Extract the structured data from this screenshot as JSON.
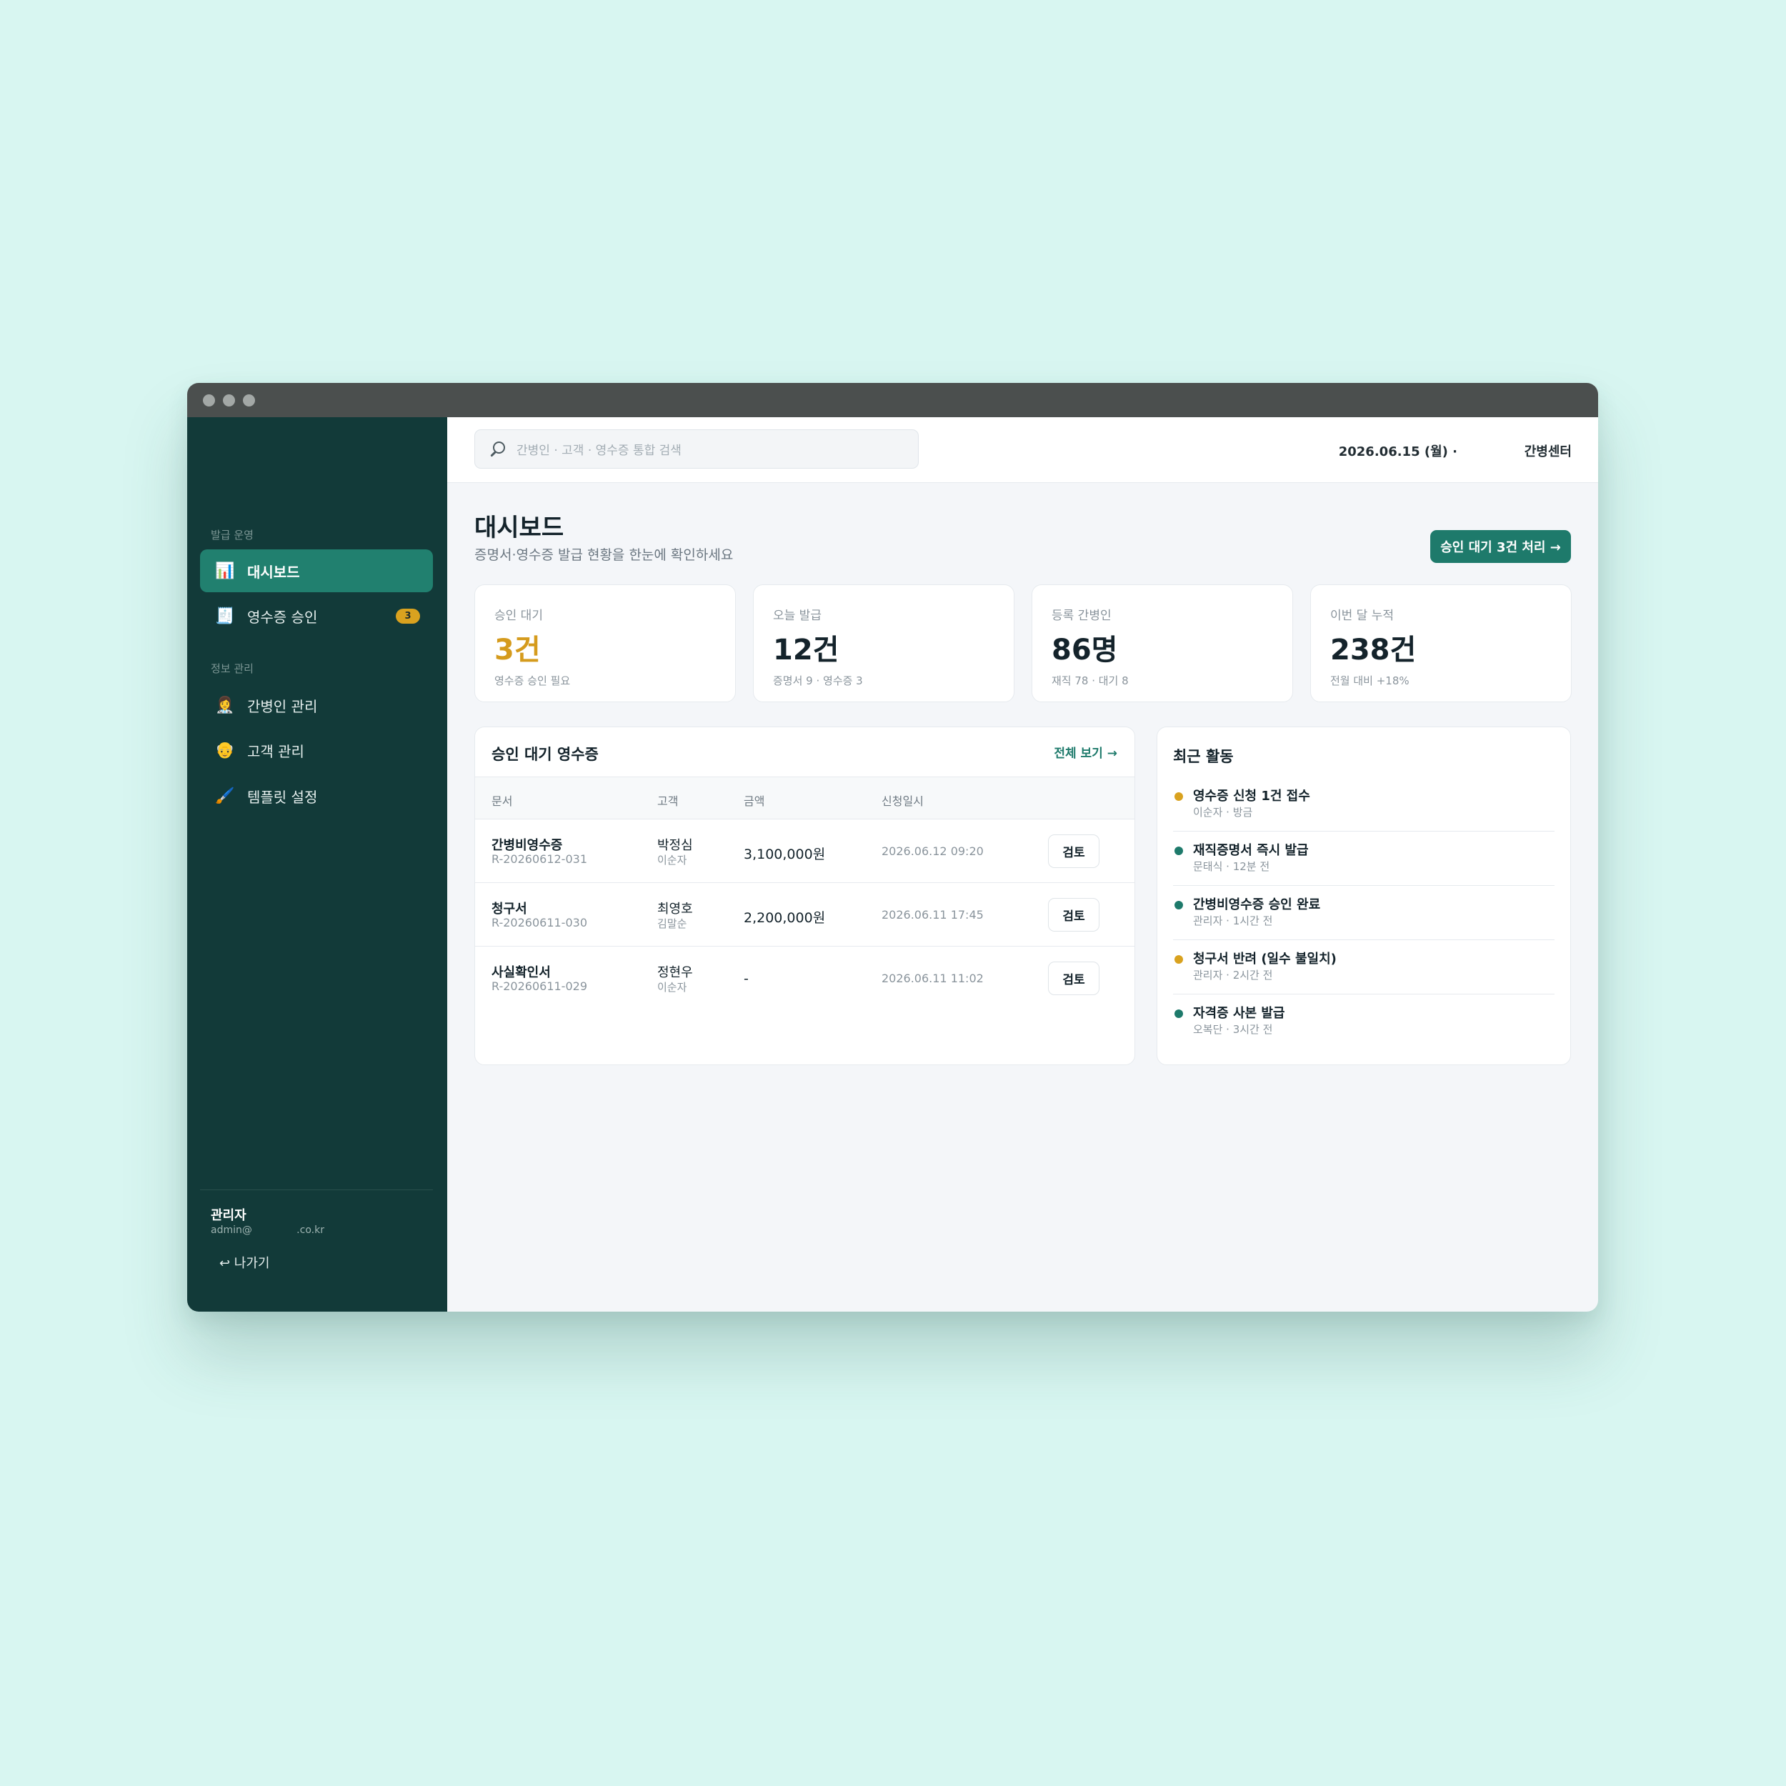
{
  "colors": {
    "accent": "#1e7a6b",
    "sidebar": "#123a39",
    "warning": "#d9a21f",
    "background": "#d8f6f1"
  },
  "sidebar": {
    "sections": [
      "발급 운영",
      "정보 관리"
    ],
    "items": [
      {
        "label": "대시보드",
        "icon": "bar-chart-icon",
        "glyph": "📊",
        "active": true
      },
      {
        "label": "영수증 승인",
        "icon": "receipt-icon",
        "glyph": "🧾",
        "badge": "3"
      },
      {
        "label": "간병인 관리",
        "icon": "caregiver-icon",
        "glyph": "👩‍⚕️"
      },
      {
        "label": "고객 관리",
        "icon": "elder-icon",
        "glyph": "👴"
      },
      {
        "label": "템플릿 설정",
        "icon": "brush-icon",
        "glyph": "🖌️"
      }
    ],
    "user": {
      "name": "관리자",
      "email": "admin@              .co.kr"
    },
    "logout_label": "↩ 나가기"
  },
  "topbar": {
    "search_placeholder": "간병인 · 고객 · 영수증 통합 검색",
    "date": "2026.06.15 (월) ·",
    "org": "간병센터"
  },
  "page": {
    "title": "대시보드",
    "subtitle": "증명서·영수증 발급 현황을 한눈에 확인하세요",
    "primary_action": "승인 대기 3건 처리 →"
  },
  "stats": [
    {
      "label": "승인 대기",
      "value": "3건",
      "sub": "영수증 승인 필요"
    },
    {
      "label": "오늘 발급",
      "value": "12건",
      "sub": "증명서 9 · 영수증 3"
    },
    {
      "label": "등록 간병인",
      "value": "86명",
      "sub": "재직 78 · 대기 8"
    },
    {
      "label": "이번 달 누적",
      "value": "238건",
      "sub": "전월 대비 +18%"
    }
  ],
  "pending": {
    "title": "승인 대기 영수증",
    "view_all": "전체 보기 →",
    "columns": [
      "문서",
      "고객",
      "금액",
      "신청일시"
    ],
    "rows": [
      {
        "doc": "간병비영수증",
        "id": "R-20260612-031",
        "customer": "박정심",
        "caregiver": "이순자",
        "amount": "3,100,000원",
        "date": "2026.06.12 09:20",
        "action": "검토"
      },
      {
        "doc": "청구서",
        "id": "R-20260611-030",
        "customer": "최영호",
        "caregiver": "김말순",
        "amount": "2,200,000원",
        "date": "2026.06.11 17:45",
        "action": "검토"
      },
      {
        "doc": "사실확인서",
        "id": "R-20260611-029",
        "customer": "정현우",
        "caregiver": "이순자",
        "amount": "-",
        "date": "2026.06.11 11:02",
        "action": "검토"
      }
    ]
  },
  "activity": {
    "title": "최근 활동",
    "items": [
      {
        "title": "영수증 신청 1건 접수",
        "meta": "이순자 · 방금",
        "status": "pending",
        "color": "#d9a21f"
      },
      {
        "title": "재직증명서 즉시 발급",
        "meta": "문태식 · 12분 전",
        "status": "done",
        "color": "#1e7a6b"
      },
      {
        "title": "간병비영수증 승인 완료",
        "meta": "관리자 · 1시간 전",
        "status": "done",
        "color": "#1e7a6b"
      },
      {
        "title": "청구서 반려 (일수 불일치)",
        "meta": "관리자 · 2시간 전",
        "status": "pending",
        "color": "#d9a21f"
      },
      {
        "title": "자격증 사본 발급",
        "meta": "오복단 · 3시간 전",
        "status": "done",
        "color": "#1e7a6b"
      }
    ]
  }
}
